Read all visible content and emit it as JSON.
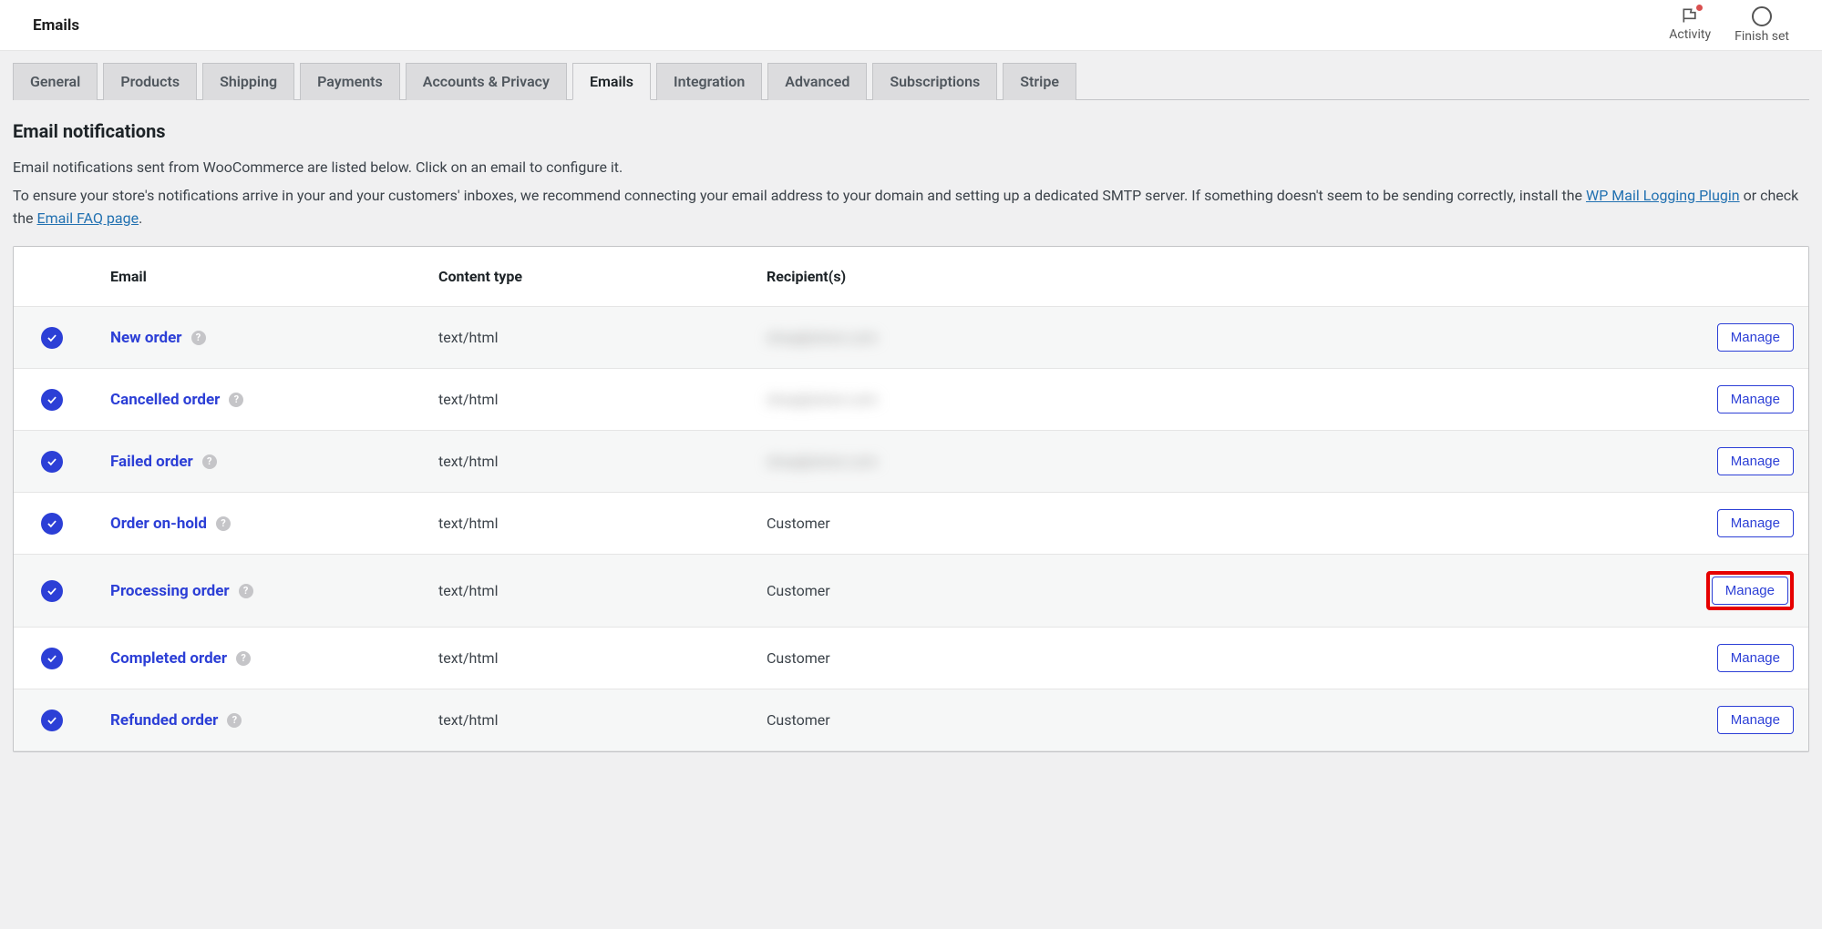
{
  "topbar": {
    "title": "Emails",
    "activity_label": "Activity",
    "finish_label": "Finish set"
  },
  "tabs": [
    {
      "label": "General",
      "active": false
    },
    {
      "label": "Products",
      "active": false
    },
    {
      "label": "Shipping",
      "active": false
    },
    {
      "label": "Payments",
      "active": false
    },
    {
      "label": "Accounts & Privacy",
      "active": false
    },
    {
      "label": "Emails",
      "active": true
    },
    {
      "label": "Integration",
      "active": false
    },
    {
      "label": "Advanced",
      "active": false
    },
    {
      "label": "Subscriptions",
      "active": false
    },
    {
      "label": "Stripe",
      "active": false
    }
  ],
  "section": {
    "heading": "Email notifications",
    "desc_line1": "Email notifications sent from WooCommerce are listed below. Click on an email to configure it.",
    "desc_line2_a": "To ensure your store's notifications arrive in your and your customers' inboxes, we recommend connecting your email address to your domain and setting up a dedicated SMTP server. If something doesn't seem to be sending correctly, install the ",
    "desc_link1": "WP Mail Logging Plugin",
    "desc_line2_b": " or check the ",
    "desc_link2": "Email FAQ page",
    "desc_line2_c": "."
  },
  "table": {
    "headers": {
      "email": "Email",
      "content_type": "Content type",
      "recipients": "Recipient(s)"
    },
    "manage_label": "Manage",
    "rows": [
      {
        "name": "New order",
        "content": "text/html",
        "recipient": "shop@store.com",
        "blurred": true,
        "highlight": false
      },
      {
        "name": "Cancelled order",
        "content": "text/html",
        "recipient": "shop@store.com",
        "blurred": true,
        "highlight": false
      },
      {
        "name": "Failed order",
        "content": "text/html",
        "recipient": "shop@store.com",
        "blurred": true,
        "highlight": false
      },
      {
        "name": "Order on-hold",
        "content": "text/html",
        "recipient": "Customer",
        "blurred": false,
        "highlight": false
      },
      {
        "name": "Processing order",
        "content": "text/html",
        "recipient": "Customer",
        "blurred": false,
        "highlight": true
      },
      {
        "name": "Completed order",
        "content": "text/html",
        "recipient": "Customer",
        "blurred": false,
        "highlight": false
      },
      {
        "name": "Refunded order",
        "content": "text/html",
        "recipient": "Customer",
        "blurred": false,
        "highlight": false
      }
    ]
  }
}
